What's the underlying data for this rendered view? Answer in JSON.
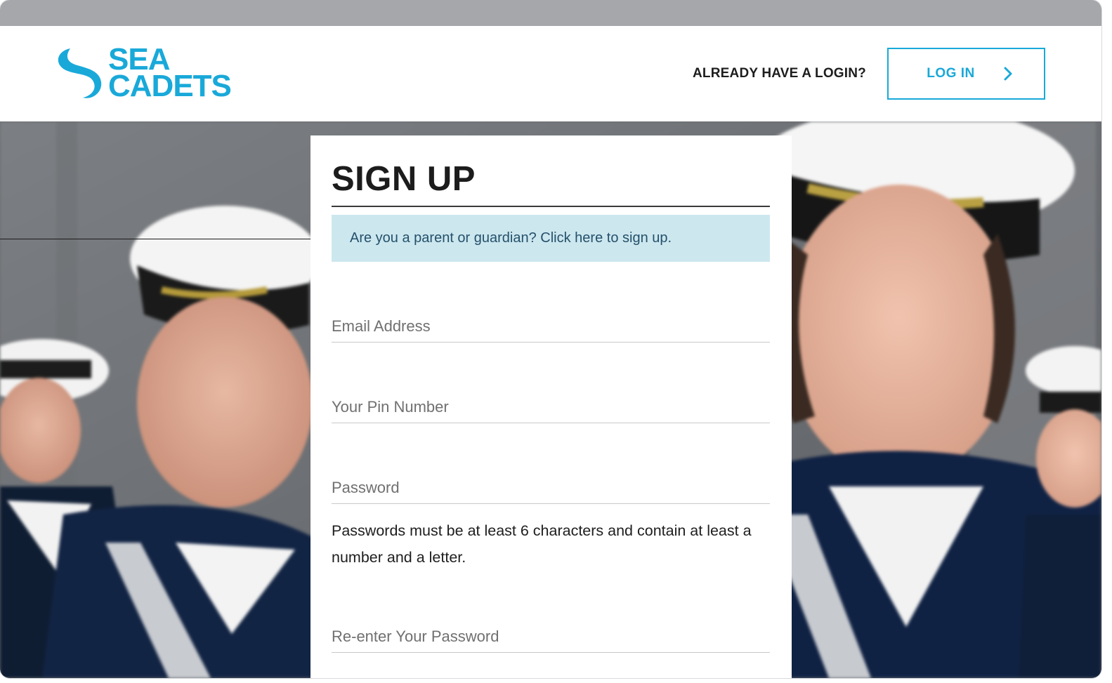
{
  "brand": {
    "logo_line1": "SEA",
    "logo_line2": "CADETS",
    "color": "#19a9d9"
  },
  "header": {
    "already_text": "ALREADY HAVE A LOGIN?",
    "login_label": "LOG IN",
    "login_icon": "chevron-right-icon"
  },
  "signup": {
    "title": "SIGN UP",
    "guardian_link": "Are you a parent or guardian? Click here to sign up.",
    "fields": {
      "email_placeholder": "Email Address",
      "pin_placeholder": "Your Pin Number",
      "password_placeholder": "Password",
      "reenter_placeholder": "Re-enter Your Password"
    },
    "password_hint": "Passwords must be at least 6 characters and contain at least a number and a letter."
  },
  "colors": {
    "accent": "#19a9d9",
    "notice_bg": "#cde7ef",
    "notice_text": "#24516a"
  }
}
